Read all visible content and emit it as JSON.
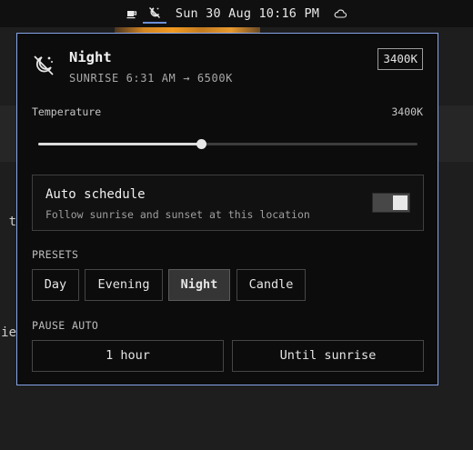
{
  "menubar": {
    "icons": [
      "coffee-icon",
      "night-mode-icon",
      "cloud-icon"
    ],
    "clock": "Sun 30 Aug 10:16 PM"
  },
  "background": {
    "fragments": [
      "t",
      "ie"
    ]
  },
  "panel": {
    "icon": "night-mode-icon",
    "title": "Night",
    "subtitle": "SUNRISE 6:31 AM → 6500K",
    "badge": "3400K",
    "temperature": {
      "label": "Temperature",
      "value_text": "3400K",
      "fraction": 0.43
    },
    "auto_schedule": {
      "title": "Auto schedule",
      "description": "Follow sunrise and sunset at this location",
      "enabled": true
    },
    "presets": {
      "label": "PRESETS",
      "items": [
        {
          "label": "Day",
          "active": false
        },
        {
          "label": "Evening",
          "active": false
        },
        {
          "label": "Night",
          "active": true
        },
        {
          "label": "Candle",
          "active": false
        }
      ]
    },
    "pause": {
      "label": "PAUSE AUTO",
      "options": [
        "1 hour",
        "Until sunrise"
      ]
    }
  },
  "colors": {
    "accent_border": "#86a5e8",
    "menubar_indicator": "#6d8fd6",
    "panel_bg": "#0c0c0c"
  }
}
